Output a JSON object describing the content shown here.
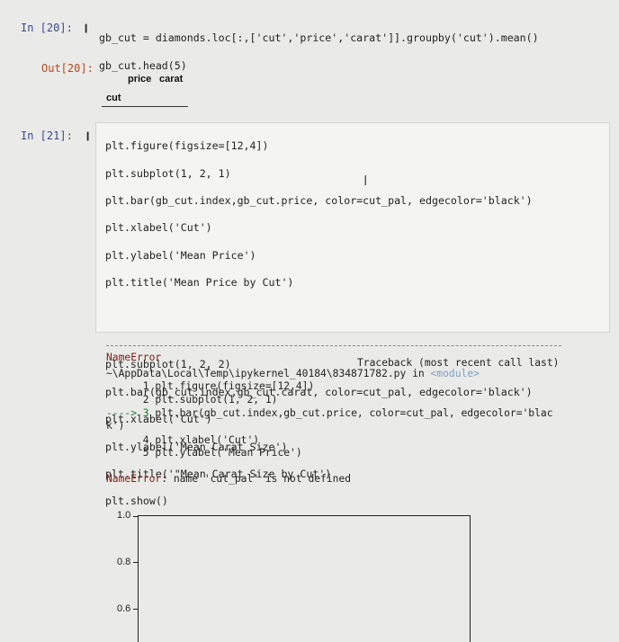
{
  "cell20": {
    "prompt": "In [20]:",
    "run_icon": "❙",
    "lines": [
      "gb_cut = diamonds.loc[:,['cut','price','carat']].groupby('cut').mean()",
      "gb_cut.head(5)"
    ],
    "out_prompt": "Out[20]:",
    "table": {
      "columns": [
        "price",
        "carat"
      ],
      "index_name": "cut"
    }
  },
  "cell21": {
    "prompt": "In [21]:",
    "run_icon": "❙",
    "lines": [
      "plt.figure(figsize=[12,4])",
      "plt.subplot(1, 2, 1)",
      "plt.bar(gb_cut.index,gb_cut.price, color=cut_pal, edgecolor='black')",
      "plt.xlabel('Cut')",
      "plt.ylabel('Mean Price')",
      "plt.title('Mean Price by Cut')",
      "",
      "",
      "plt.subplot(1, 2, 2)",
      "plt.bar(gb_cut.index,gb_cut.carat, color=cut_pal, edgecolor='black')",
      "plt.xlabel('Cut')",
      "plt.ylabel('Mean Carat Size')",
      "plt.title('\"Mean Carat Size by Cut')",
      "plt.show()"
    ]
  },
  "traceback": {
    "error_name": "NameError",
    "header_right": "Traceback (most recent call last)",
    "path": "~\\AppData\\Local\\Temp\\ipykernel_40184\\834871782.py in ",
    "module": "<module>",
    "lines": [
      {
        "prefix": "      1 ",
        "code": "plt.figure(figsize=[12,4])"
      },
      {
        "prefix": "      2 ",
        "code": "plt.subplot(1, 2, 1)"
      },
      {
        "prefix": "----> 3 ",
        "code": "plt.bar(gb_cut.index,gb_cut.price, color=cut_pal, edgecolor='blac"
      },
      {
        "prefix": "",
        "code": "k')"
      },
      {
        "prefix": "      4 ",
        "code": "plt.xlabel('Cut')"
      },
      {
        "prefix": "      5 ",
        "code": "plt.ylabel('Mean Price')"
      }
    ],
    "message_name": "NameError",
    "message": ": name 'cut_pal' is not defined"
  },
  "plot": {
    "yticks": [
      "1.0",
      "0.8",
      "0.6"
    ]
  }
}
